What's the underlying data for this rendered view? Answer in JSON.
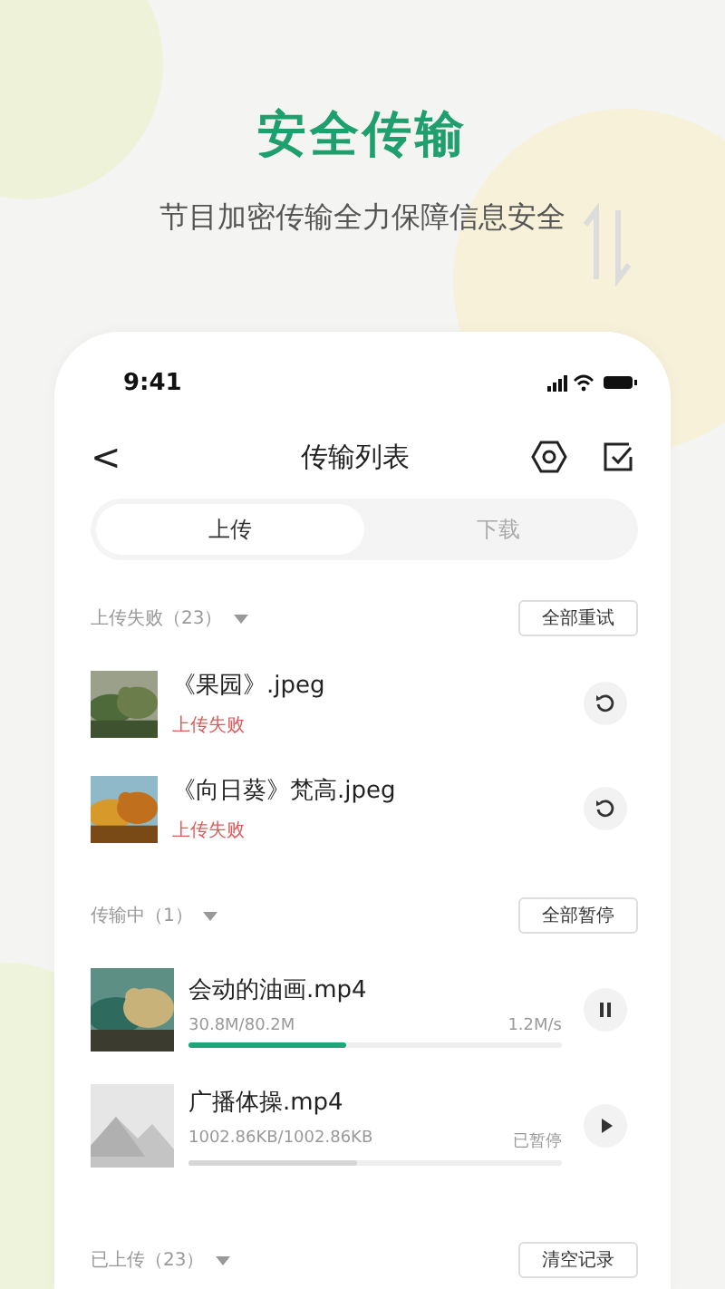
{
  "headline": "安全传输",
  "subtitle": "节目加密传输全力保障信息安全",
  "status_bar": {
    "time": "9:41"
  },
  "nav": {
    "back": "<",
    "title": "传输列表"
  },
  "tabs": [
    {
      "label": "上传",
      "selected": true
    },
    {
      "label": "下载",
      "selected": false
    }
  ],
  "sections": [
    {
      "title": "上传失败（23）",
      "action": "全部重试",
      "items": [
        {
          "kind": "failed",
          "name": "《果园》.jpeg",
          "status": "上传失败"
        },
        {
          "kind": "failed",
          "name": "《向日葵》梵高.jpeg",
          "status": "上传失败"
        }
      ]
    },
    {
      "title": "传输中（1）",
      "action": "全部暂停",
      "items": [
        {
          "kind": "active",
          "name": "会动的油画.mp4",
          "size": "30.8M/80.2M",
          "status": "1.2M/s",
          "level": 0.42
        },
        {
          "kind": "paused",
          "thumbnail": {
            "kind": "placeholder"
          },
          "name": "广播体操.mp4",
          "size": "1002.86KB/1002.86KB",
          "status": "已暂停",
          "level": 0.45
        }
      ]
    },
    {
      "title": "已上传（23）",
      "action": "清空记录"
    }
  ]
}
